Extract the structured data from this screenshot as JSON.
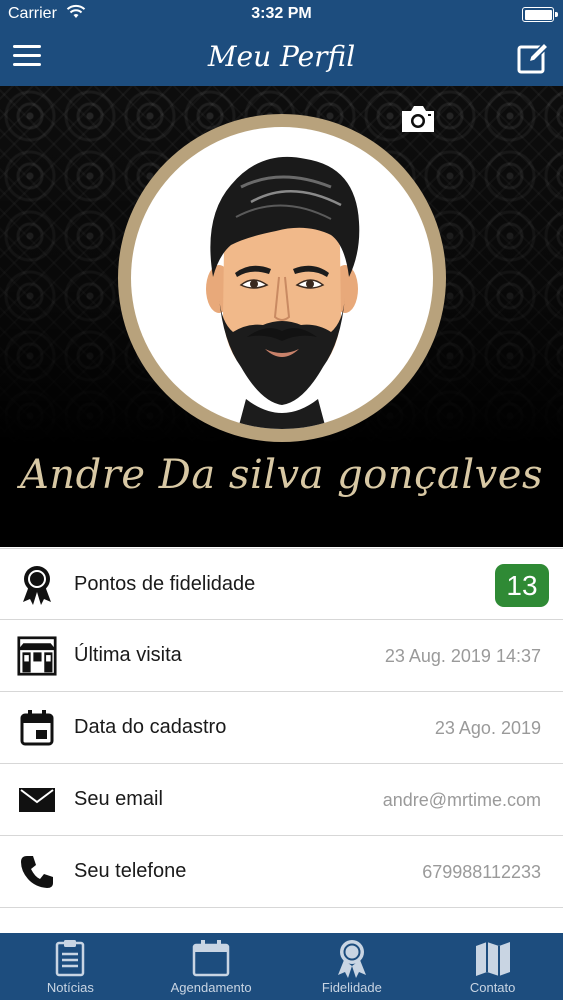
{
  "status_bar": {
    "carrier": "Carrier",
    "time": "3:32 PM"
  },
  "nav": {
    "title": "Meu Perfil",
    "menu_icon": "hamburger-menu-icon",
    "edit_icon": "edit-pencil-icon"
  },
  "profile": {
    "name": "Andre Da silva gonçalves",
    "camera_icon": "camera-icon",
    "ring_color": "#b8a27c"
  },
  "info_rows": [
    {
      "icon": "award-ribbon-icon",
      "label": "Pontos de fidelidade",
      "points": "13"
    },
    {
      "icon": "storefront-icon",
      "label": "Última visita",
      "value": "23 Aug. 2019 14:37"
    },
    {
      "icon": "calendar-icon",
      "label": "Data do cadastro",
      "value": "23 Ago. 2019"
    },
    {
      "icon": "envelope-icon",
      "label": "Seu email",
      "value": "andre@mrtime.com"
    },
    {
      "icon": "phone-icon",
      "label": "Seu telefone",
      "value": "679988112233"
    }
  ],
  "tabs": [
    {
      "icon": "clipboard-icon",
      "label": "Notícias"
    },
    {
      "icon": "calendar-icon",
      "label": "Agendamento"
    },
    {
      "icon": "award-ribbon-icon",
      "label": "Fidelidade"
    },
    {
      "icon": "map-icon",
      "label": "Contato"
    }
  ],
  "colors": {
    "primary": "#1d4d7e",
    "badge_green": "#2f8a35",
    "name_gold": "#d8c8a4"
  }
}
